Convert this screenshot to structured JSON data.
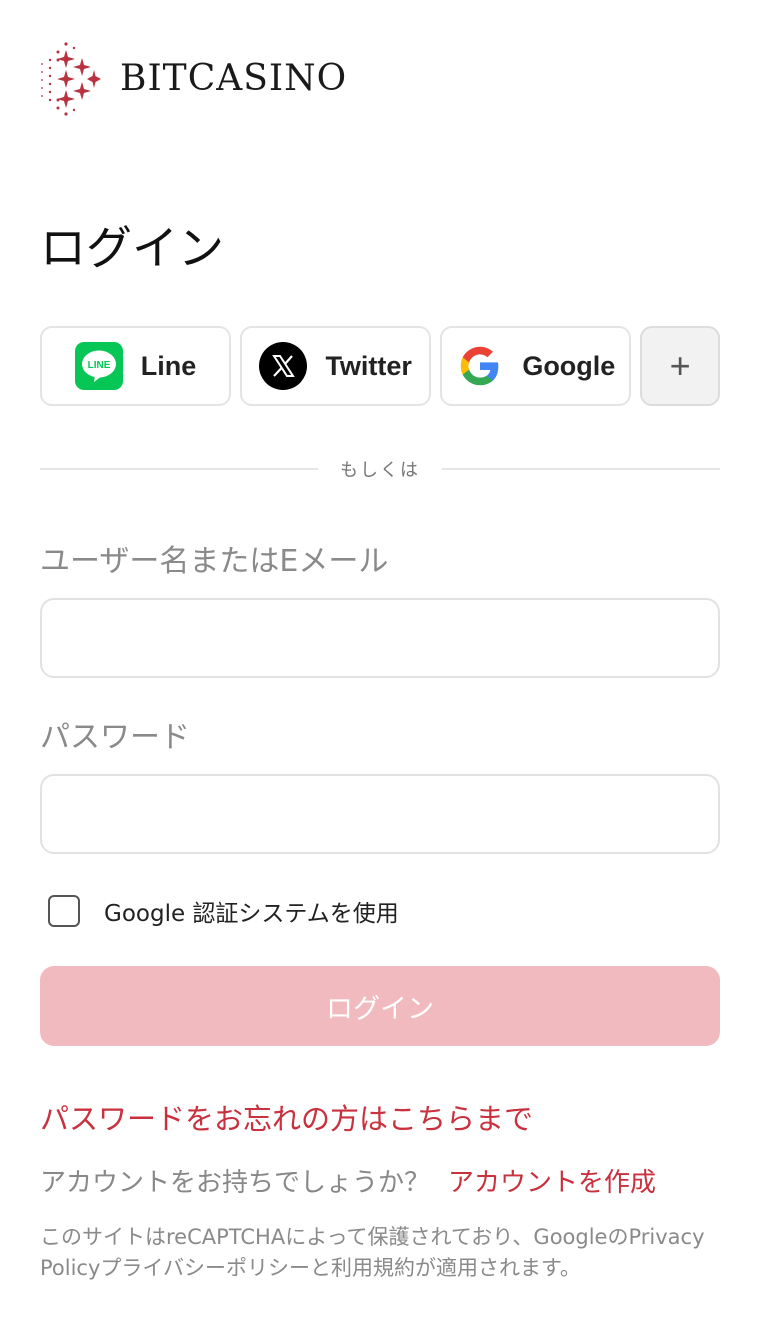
{
  "brand": {
    "name": "BITCASINO",
    "accent": "#c8313d"
  },
  "page_title": "ログイン",
  "social": [
    {
      "label": "Line",
      "icon": "line-icon"
    },
    {
      "label": "Twitter",
      "icon": "x-twitter-icon"
    },
    {
      "label": "Google",
      "icon": "google-icon"
    }
  ],
  "more_label": "+",
  "divider_text": "もしくは",
  "form": {
    "username_label": "ユーザー名またはEメール",
    "username_value": "",
    "password_label": "パスワード",
    "password_value": "",
    "authenticator_label": "Google 認証システムを使用",
    "login_button": "ログイン",
    "login_button_color": "#f1babf"
  },
  "forgot_password": "パスワードをお忘れの方はこちらまで",
  "signup": {
    "prompt": "アカウントをお持ちでしょうか？",
    "link": "アカウントを作成"
  },
  "recaptcha_notice": "このサイトはreCAPTCHAによって保護されており、GoogleのPrivacy Policyプライバシーポリシーと利用規約が適用されます。"
}
